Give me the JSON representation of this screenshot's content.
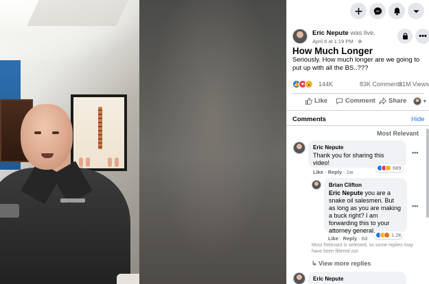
{
  "topbar": {
    "icons": [
      "plus-icon",
      "messenger-icon",
      "bell-icon",
      "chevron-down-icon"
    ]
  },
  "post": {
    "author": "Eric Nepute",
    "action": "was live.",
    "date": "April 6 at 1:19 PM",
    "privacy_icon": "globe-icon",
    "title": "How Much Longer",
    "body": "Seriously. How much longer are we going to put up with all the BS..???",
    "reactions": "144K",
    "comments": "83K Comments",
    "views": "21M Views"
  },
  "actions": {
    "like": "Like",
    "comment": "Comment",
    "share": "Share"
  },
  "comments_section": {
    "title": "Comments",
    "hide": "Hide",
    "sort": "Most Relevant",
    "filter_note": "Most Relevant is selected, so some replies may have been filtered out.",
    "view_more": "View more replies",
    "items": [
      {
        "name": "Eric Nepute",
        "text": "Thank you for sharing this video!",
        "like": "Like",
        "reply": "Reply",
        "time": "1w",
        "reaction_count": "689"
      },
      {
        "name": "Brian Clifton",
        "mention": "Eric Nepute",
        "text": "you are a snake oil salesmen. But as long as you are making a buck right? I am forwarding this to your attorney general.",
        "like": "Like",
        "reply": "Reply",
        "time": "6d",
        "reaction_count": "1.2K"
      },
      {
        "name": "Eric Nepute"
      }
    ]
  },
  "colors": {
    "accent": "#1877f2",
    "like_blue": "#1877f2",
    "love_red": "#f33e58",
    "haha_yellow": "#f7b125",
    "text_secondary": "#65676b"
  }
}
